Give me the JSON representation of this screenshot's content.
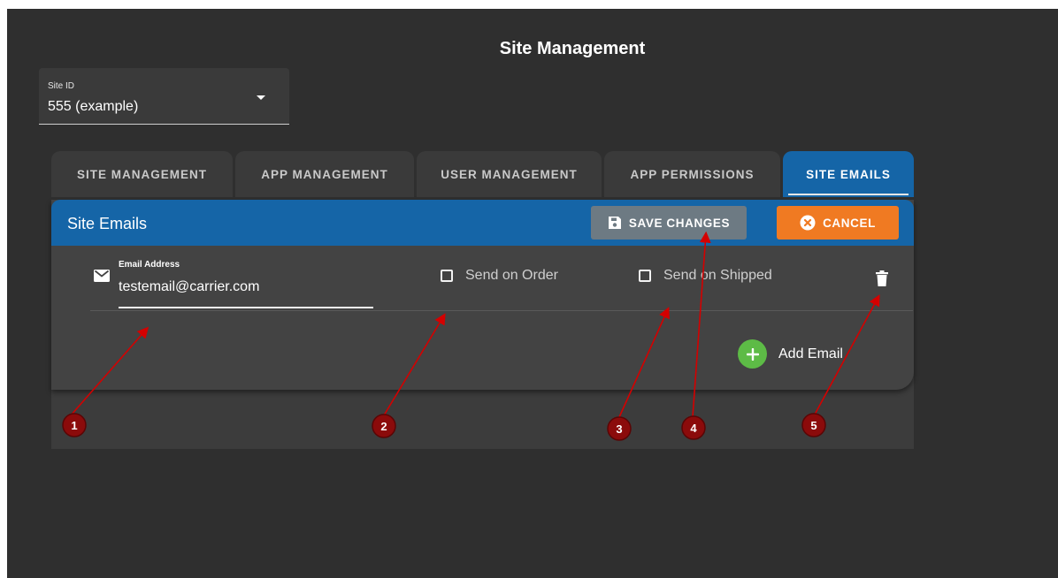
{
  "page": {
    "title": "Site Management"
  },
  "site_select": {
    "label": "Site ID",
    "value": "555 (example)"
  },
  "tabs": [
    {
      "label": "SITE MANAGEMENT",
      "active": false
    },
    {
      "label": "APP MANAGEMENT",
      "active": false
    },
    {
      "label": "USER MANAGEMENT",
      "active": false
    },
    {
      "label": "APP PERMISSIONS",
      "active": false
    },
    {
      "label": "SITE EMAILS",
      "active": true
    }
  ],
  "card": {
    "title": "Site Emails",
    "save_label": "SAVE CHANGES",
    "cancel_label": "CANCEL"
  },
  "email_row": {
    "field_label": "Email Address",
    "email_value": "testemail@carrier.com",
    "send_on_order_label": "Send on Order",
    "send_on_order_checked": false,
    "send_on_shipped_label": "Send on Shipped",
    "send_on_shipped_checked": false
  },
  "add_email_label": "Add Email",
  "annotation_markers": [
    "1",
    "2",
    "3",
    "4",
    "5"
  ],
  "colors": {
    "background": "#2f2f2f",
    "primary_blue": "#1565a7",
    "cancel_orange": "#f07a22",
    "save_gray": "#6d7a83",
    "add_green": "#5dbb46",
    "marker_red": "#8b0b0b",
    "arrow_red": "#d40000"
  }
}
